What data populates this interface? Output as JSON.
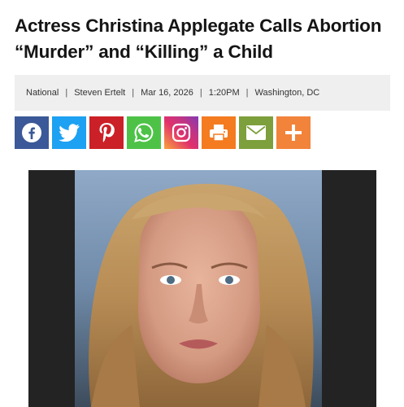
{
  "article": {
    "headline_line1": "Actress Christina Applegate Calls Abortion",
    "headline_line2": "“Murder” and “Killing” a Child"
  },
  "meta": {
    "section": "National",
    "author": "Steven Ertelt",
    "date": "Mar 16, 2026",
    "time": "1:20PM",
    "location": "Washington, DC"
  },
  "share_buttons": [
    {
      "icon": "facebook-icon",
      "color": "#3b5998"
    },
    {
      "icon": "twitter-icon",
      "color": "#1da1f2"
    },
    {
      "icon": "pinterest-icon",
      "color": "#cb2027"
    },
    {
      "icon": "whatsapp-icon",
      "color": "#4dc247"
    },
    {
      "icon": "instagram-icon",
      "color": "#c13584"
    },
    {
      "icon": "print-icon",
      "color": "#f47b20"
    },
    {
      "icon": "email-icon",
      "color": "#7d9f3c"
    },
    {
      "icon": "more-icon",
      "color": "#f2833a"
    }
  ],
  "colors": {
    "meta_bar_bg": "#efefef",
    "photo_frame": "#232323"
  }
}
